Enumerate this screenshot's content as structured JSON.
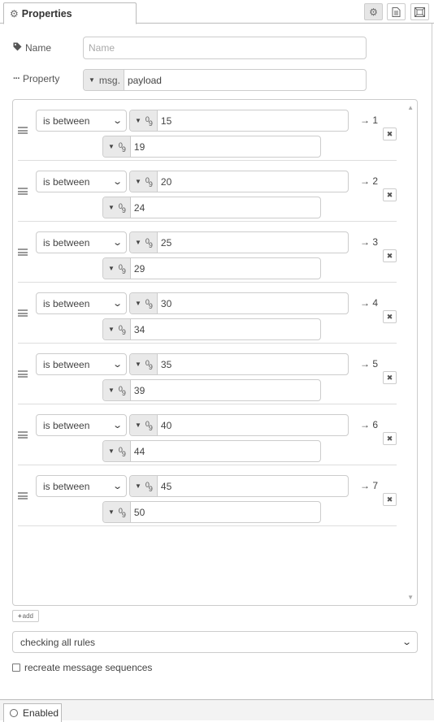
{
  "tab": {
    "title": "Properties"
  },
  "toolbar": {
    "icons": [
      "gear-icon",
      "document-icon",
      "frame-icon"
    ]
  },
  "name_field": {
    "label": "Name",
    "placeholder": "Name",
    "value": ""
  },
  "property_field": {
    "label": "Property",
    "type": "msg.",
    "value": "payload"
  },
  "rules": [
    {
      "operator": "is between",
      "value1": "15",
      "value2": "19",
      "output": "→ 1"
    },
    {
      "operator": "is between",
      "value1": "20",
      "value2": "24",
      "output": "→ 2"
    },
    {
      "operator": "is between",
      "value1": "25",
      "value2": "29",
      "output": "→ 3"
    },
    {
      "operator": "is between",
      "value1": "30",
      "value2": "34",
      "output": "→ 4"
    },
    {
      "operator": "is between",
      "value1": "35",
      "value2": "39",
      "output": "→ 5"
    },
    {
      "operator": "is between",
      "value1": "40",
      "value2": "44",
      "output": "→ 6"
    },
    {
      "operator": "is between",
      "value1": "45",
      "value2": "50",
      "output": "→ 7"
    }
  ],
  "add_button": {
    "label": "add"
  },
  "check_mode": {
    "value": "checking all rules"
  },
  "recreate": {
    "label": "recreate message sequences",
    "checked": false
  },
  "footer": {
    "label": "Enabled"
  }
}
